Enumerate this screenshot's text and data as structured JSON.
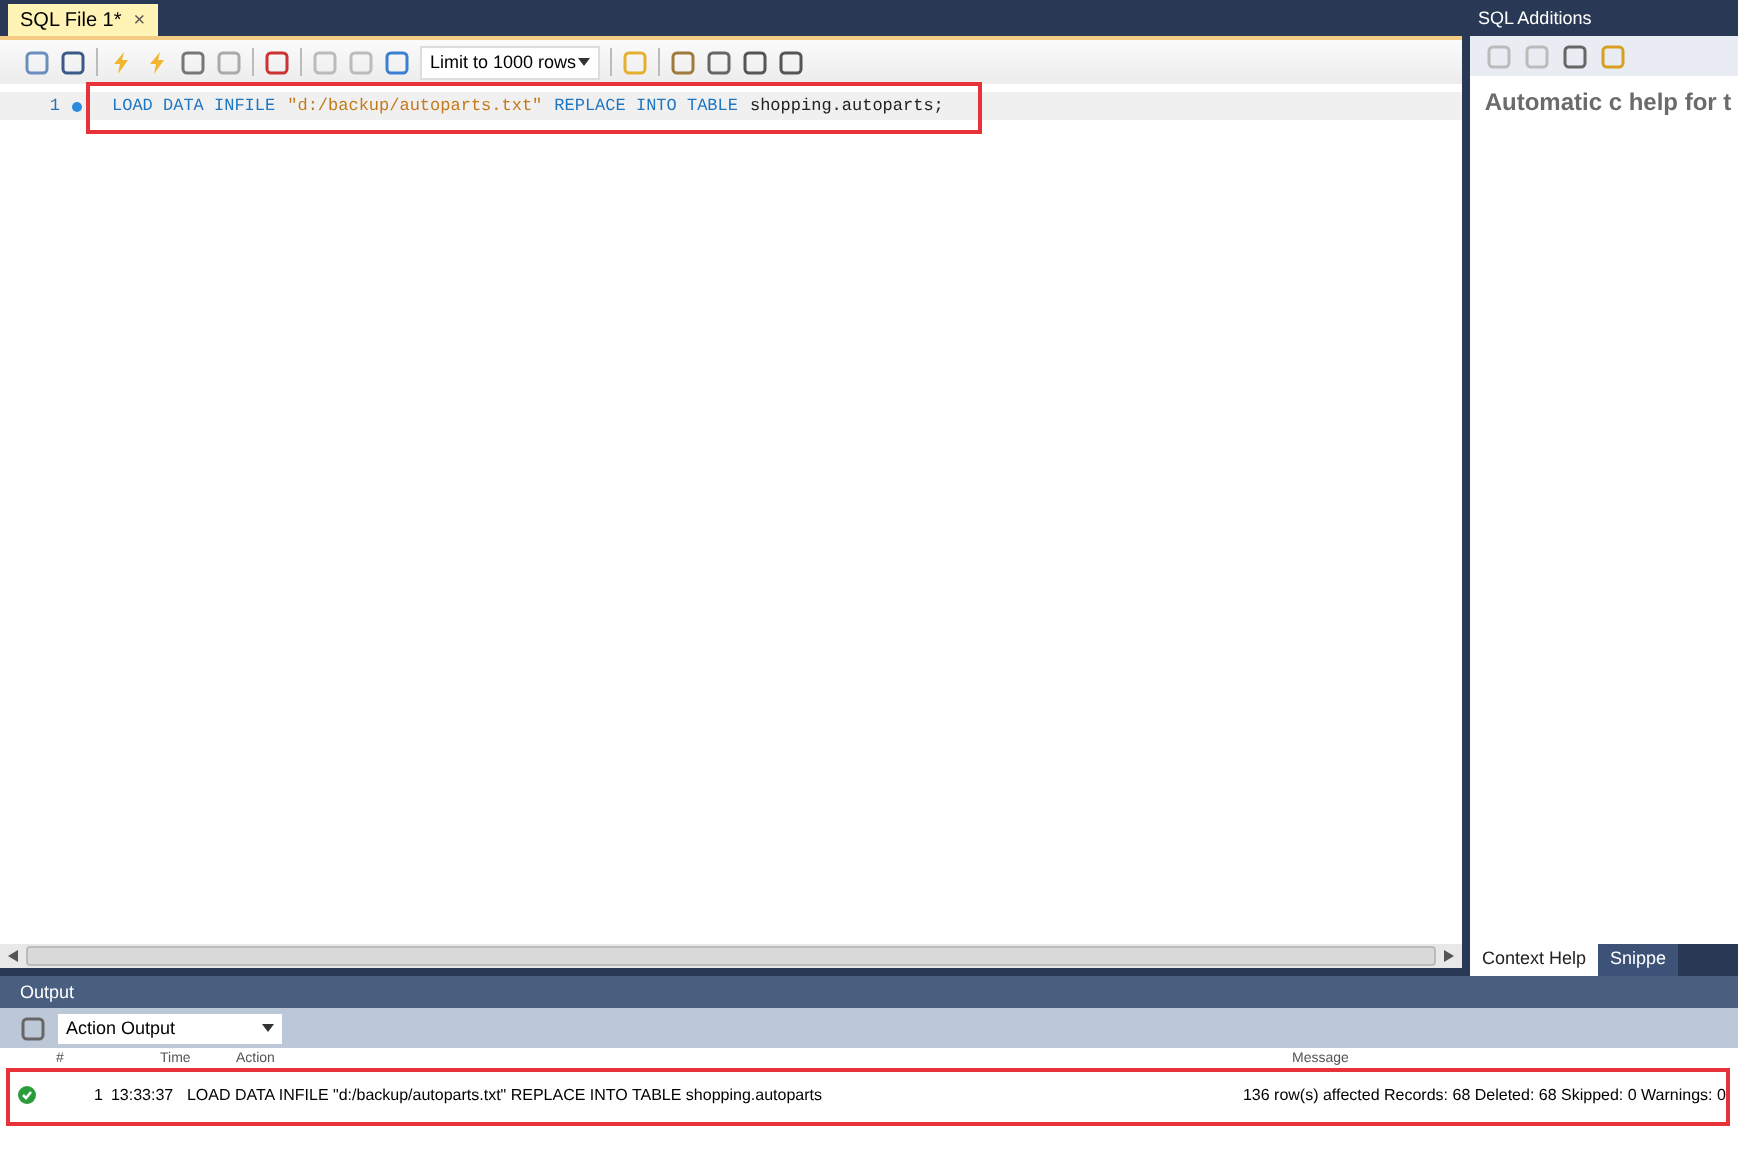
{
  "editor_tab": {
    "label": "SQL File 1*",
    "close": "×",
    "selected": true
  },
  "toolbar": {
    "limit_select": "Limit to 1000 rows"
  },
  "editor": {
    "lines": [
      {
        "number": "1",
        "tokens": [
          {
            "kind": "keyword",
            "text": "LOAD DATA INFILE"
          },
          {
            "kind": "string",
            "text": "\"d:/backup/autoparts.txt\""
          },
          {
            "kind": "keyword",
            "text": "REPLACE INTO TABLE"
          },
          {
            "kind": "plain",
            "text": "shopping.autoparts;"
          }
        ]
      }
    ]
  },
  "side_panel": {
    "title": "SQL Additions",
    "help_text": "Automatic c help for t",
    "tabs": [
      {
        "label": "Context Help",
        "selected": true
      },
      {
        "label": "Snippe",
        "selected": false
      }
    ]
  },
  "output": {
    "title": "Output",
    "select": "Action Output",
    "columns": [
      "#",
      "Time",
      "Action",
      "Message"
    ],
    "rows": [
      {
        "success": true,
        "number": "1",
        "time": "13:33:37",
        "action": "LOAD DATA INFILE \"d:/backup/autoparts.txt\" REPLACE INTO TABLE shopping.autoparts",
        "message": "136 row(s) affected Records: 68  Deleted: 68  Skipped: 0  Warnings: 0"
      }
    ]
  }
}
